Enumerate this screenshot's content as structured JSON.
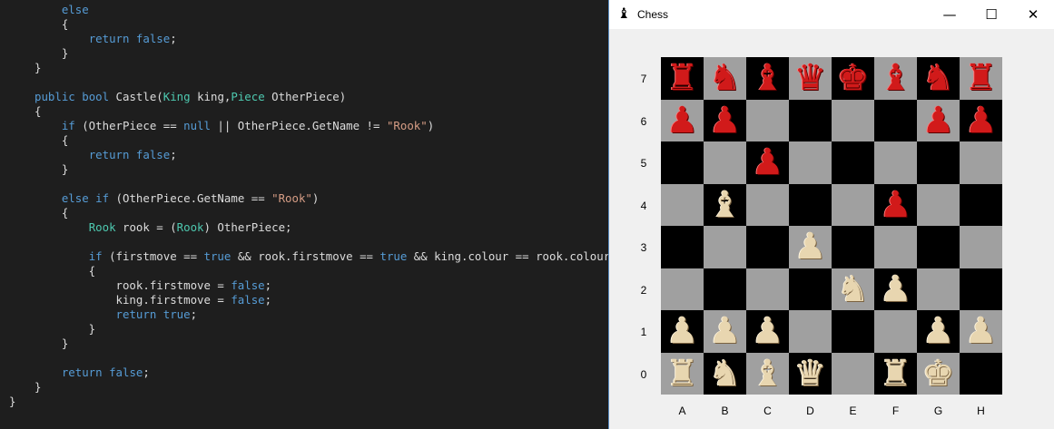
{
  "editor": {
    "lines": [
      [
        [
          "kw",
          "    else"
        ]
      ],
      [
        [
          "pl",
          "    {"
        ]
      ],
      [
        [
          "pl",
          "        "
        ],
        [
          "kw",
          "return"
        ],
        [
          "pl",
          " "
        ],
        [
          "kw",
          "false"
        ],
        [
          "pl",
          ";"
        ]
      ],
      [
        [
          "pl",
          "    }"
        ]
      ],
      [
        [
          "pl",
          "}"
        ]
      ],
      [
        [
          "pl",
          ""
        ]
      ],
      [
        [
          "kw",
          "public"
        ],
        [
          "pl",
          " "
        ],
        [
          "kw",
          "bool"
        ],
        [
          "pl",
          " Castle("
        ],
        [
          "ty",
          "King"
        ],
        [
          "pl",
          " king,"
        ],
        [
          "ty",
          "Piece"
        ],
        [
          "pl",
          " OtherPiece)"
        ]
      ],
      [
        [
          "pl",
          "{"
        ]
      ],
      [
        [
          "pl",
          "    "
        ],
        [
          "kw",
          "if"
        ],
        [
          "pl",
          " (OtherPiece == "
        ],
        [
          "kw",
          "null"
        ],
        [
          "pl",
          " || OtherPiece.GetName != "
        ],
        [
          "st",
          "\"Rook\""
        ],
        [
          "pl",
          ")"
        ]
      ],
      [
        [
          "pl",
          "    {"
        ]
      ],
      [
        [
          "pl",
          "        "
        ],
        [
          "kw",
          "return"
        ],
        [
          "pl",
          " "
        ],
        [
          "kw",
          "false"
        ],
        [
          "pl",
          ";"
        ]
      ],
      [
        [
          "pl",
          "    }"
        ]
      ],
      [
        [
          "pl",
          ""
        ]
      ],
      [
        [
          "pl",
          "    "
        ],
        [
          "kw",
          "else"
        ],
        [
          "pl",
          " "
        ],
        [
          "kw",
          "if"
        ],
        [
          "pl",
          " (OtherPiece.GetName == "
        ],
        [
          "st",
          "\"Rook\""
        ],
        [
          "pl",
          ")"
        ]
      ],
      [
        [
          "pl",
          "    {"
        ]
      ],
      [
        [
          "pl",
          "        "
        ],
        [
          "ty",
          "Rook"
        ],
        [
          "pl",
          " rook = ("
        ],
        [
          "ty",
          "Rook"
        ],
        [
          "pl",
          ") OtherPiece;"
        ]
      ],
      [
        [
          "pl",
          ""
        ]
      ],
      [
        [
          "pl",
          "        "
        ],
        [
          "kw",
          "if"
        ],
        [
          "pl",
          " (firstmove == "
        ],
        [
          "kw",
          "true"
        ],
        [
          "pl",
          " && rook.firstmove == "
        ],
        [
          "kw",
          "true"
        ],
        [
          "pl",
          " && king.colour == rook.colour)"
        ]
      ],
      [
        [
          "pl",
          "        {"
        ]
      ],
      [
        [
          "pl",
          "            rook.firstmove = "
        ],
        [
          "kw",
          "false"
        ],
        [
          "pl",
          ";"
        ]
      ],
      [
        [
          "pl",
          "            king.firstmove = "
        ],
        [
          "kw",
          "false"
        ],
        [
          "pl",
          ";"
        ]
      ],
      [
        [
          "pl",
          "            "
        ],
        [
          "kw",
          "return"
        ],
        [
          "pl",
          " "
        ],
        [
          "kw",
          "true"
        ],
        [
          "pl",
          ";"
        ]
      ],
      [
        [
          "pl",
          "        }"
        ]
      ],
      [
        [
          "pl",
          "    }"
        ]
      ],
      [
        [
          "pl",
          ""
        ]
      ],
      [
        [
          "pl",
          "    "
        ],
        [
          "kw",
          "return"
        ],
        [
          "pl",
          " "
        ],
        [
          "kw",
          "false"
        ],
        [
          "pl",
          ";"
        ]
      ],
      [
        [
          "pl",
          "}"
        ]
      ],
      [
        [
          "pl",
          "}"
        ]
      ]
    ]
  },
  "window": {
    "title": "Chess",
    "app_icon": "chess-pieces-icon",
    "minimize_glyph": "—",
    "maximize_glyph": "☐",
    "close_glyph": "✕"
  },
  "board": {
    "ranks": [
      "7",
      "6",
      "5",
      "4",
      "3",
      "2",
      "1",
      "0"
    ],
    "files": [
      "A",
      "B",
      "C",
      "D",
      "E",
      "F",
      "G",
      "H"
    ],
    "glyphs": {
      "rook": "♜",
      "knight": "♞",
      "bishop": "♝",
      "queen": "♛",
      "king": "♚",
      "pawn": "♟"
    },
    "pieces": {
      "7": [
        [
          "red",
          "rook"
        ],
        [
          "red",
          "knight"
        ],
        [
          "red",
          "bishop"
        ],
        [
          "red",
          "queen"
        ],
        [
          "red",
          "king"
        ],
        [
          "red",
          "bishop"
        ],
        [
          "red",
          "knight"
        ],
        [
          "red",
          "rook"
        ]
      ],
      "6": [
        [
          "red",
          "pawn"
        ],
        [
          "red",
          "pawn"
        ],
        null,
        null,
        null,
        null,
        [
          "red",
          "pawn"
        ],
        [
          "red",
          "pawn"
        ]
      ],
      "5": [
        null,
        null,
        [
          "red",
          "pawn"
        ],
        null,
        null,
        null,
        null,
        null
      ],
      "4": [
        null,
        [
          "cream",
          "bishop"
        ],
        null,
        null,
        null,
        [
          "red",
          "pawn"
        ],
        null,
        null
      ],
      "3": [
        null,
        null,
        null,
        [
          "cream",
          "pawn"
        ],
        null,
        null,
        null,
        null
      ],
      "2": [
        null,
        null,
        null,
        null,
        [
          "cream",
          "knight"
        ],
        [
          "cream",
          "pawn"
        ],
        null,
        null
      ],
      "1": [
        [
          "cream",
          "pawn"
        ],
        [
          "cream",
          "pawn"
        ],
        [
          "cream",
          "pawn"
        ],
        null,
        null,
        null,
        [
          "cream",
          "pawn"
        ],
        [
          "cream",
          "pawn"
        ]
      ],
      "0": [
        [
          "cream",
          "rook"
        ],
        [
          "cream",
          "knight"
        ],
        [
          "cream",
          "bishop"
        ],
        [
          "cream",
          "queen"
        ],
        null,
        [
          "cream",
          "rook"
        ],
        [
          "cream",
          "king"
        ],
        null
      ]
    }
  }
}
